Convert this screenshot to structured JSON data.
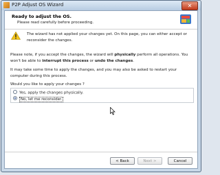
{
  "window": {
    "title": "P2P Adjust OS Wizard",
    "close_glyph": "✕"
  },
  "header": {
    "title": "Ready to adjust the OS.",
    "subtitle": "Please read carefully before proceeding."
  },
  "warning": {
    "text": "The wizard has not applied your changes yet. On this page, you can either accept or reconsider the changes."
  },
  "note": {
    "part1": "Please note, if you accept the changes, the wizard will ",
    "bold1": "physically",
    "part2": " perform all operations. You won't be able to ",
    "bold2": "interrupt this process",
    "part3": " or ",
    "bold3": "undo the changes",
    "part4": "."
  },
  "restart_note": "It may take some time to apply the changes, and you may also be asked to restart your computer during this process.",
  "question": "Would you like to apply your changes ?",
  "options": [
    {
      "label": "Yes, apply the changes physically.",
      "checked": false
    },
    {
      "label": "No, let me reconsider.",
      "checked": true
    }
  ],
  "footer": {
    "back_label": "< Back",
    "next_label": "Next >",
    "cancel_label": "Cancel"
  },
  "icons": {
    "title_icon": "wizard-app-icon",
    "header_logo": "partition-wizard-logo",
    "warning_icon": "warning-icon",
    "cursor": "mouse-pointer-icon"
  },
  "colors": {
    "window_frame": "#c9d8e8",
    "close_button": "#c23a1a",
    "warning_yellow": "#f5c518",
    "radio_selected": "#2a4f9a"
  }
}
